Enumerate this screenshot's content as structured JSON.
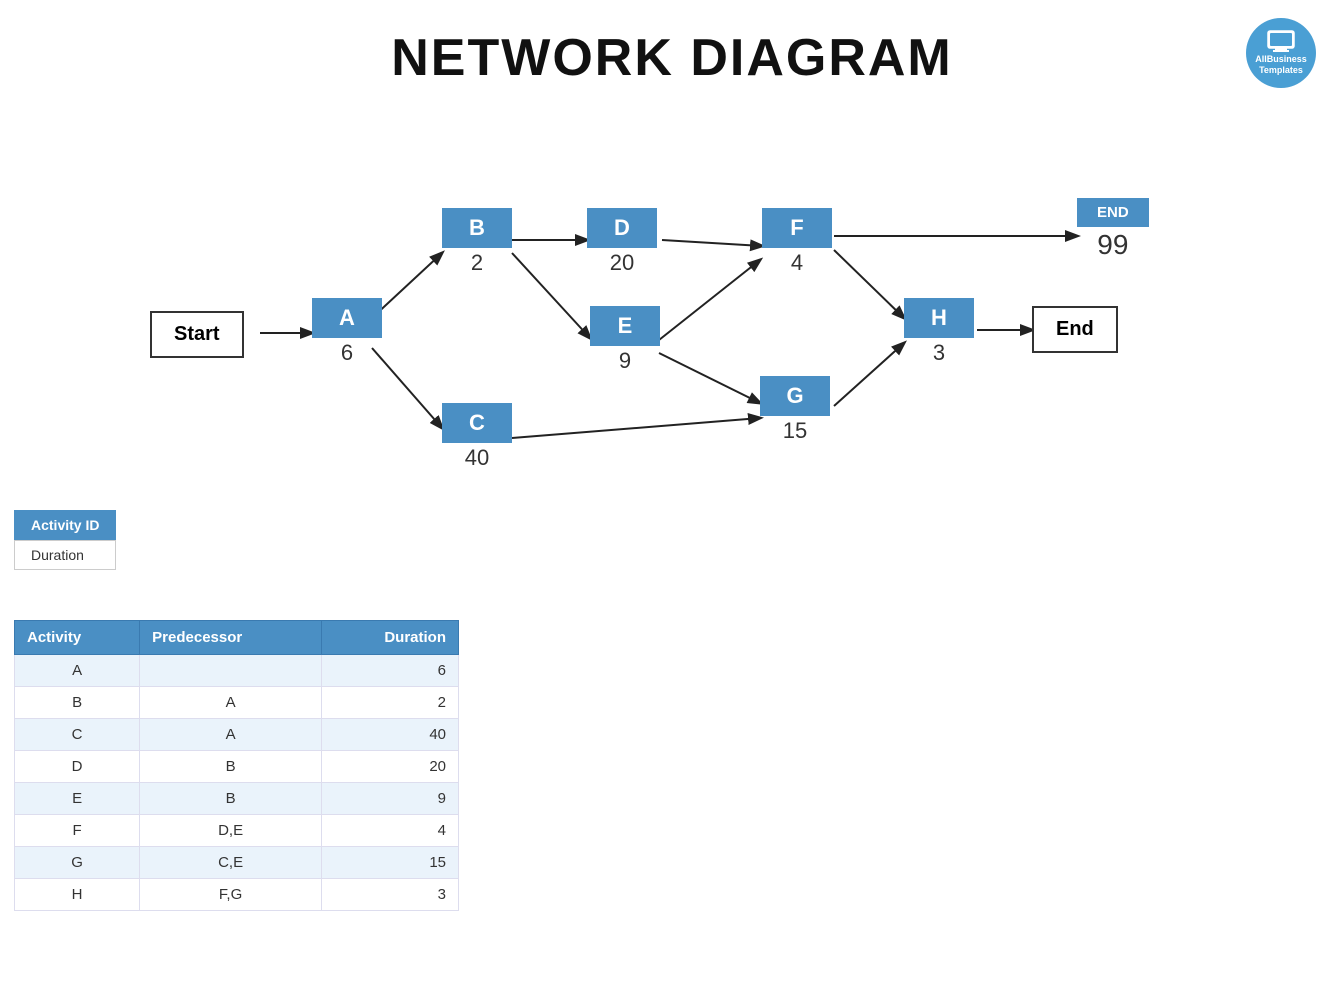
{
  "title": "NETWORK DIAGRAM",
  "logo": {
    "line1": "AllBusiness",
    "line2": "Templates"
  },
  "legend": {
    "activity_id_label": "Activity ID",
    "duration_label": "Duration"
  },
  "nodes": {
    "start": {
      "label": "Start",
      "duration": null
    },
    "end_node": {
      "label": "End",
      "duration": null
    },
    "end_special": {
      "label": "END",
      "duration": "99"
    },
    "A": {
      "label": "A",
      "duration": "6"
    },
    "B": {
      "label": "B",
      "duration": "2"
    },
    "C": {
      "label": "C",
      "duration": "40"
    },
    "D": {
      "label": "D",
      "duration": "20"
    },
    "E": {
      "label": "E",
      "duration": "9"
    },
    "F": {
      "label": "F",
      "duration": "4"
    },
    "G": {
      "label": "G",
      "duration": "15"
    },
    "H": {
      "label": "H",
      "duration": "3"
    }
  },
  "table": {
    "headers": [
      "Activity",
      "Predecessor",
      "Duration"
    ],
    "rows": [
      {
        "activity": "A",
        "predecessor": "",
        "duration": "6"
      },
      {
        "activity": "B",
        "predecessor": "A",
        "duration": "2"
      },
      {
        "activity": "C",
        "predecessor": "A",
        "duration": "40"
      },
      {
        "activity": "D",
        "predecessor": "B",
        "duration": "20"
      },
      {
        "activity": "E",
        "predecessor": "B",
        "duration": "9"
      },
      {
        "activity": "F",
        "predecessor": "D,E",
        "duration": "4"
      },
      {
        "activity": "G",
        "predecessor": "C,E",
        "duration": "15"
      },
      {
        "activity": "H",
        "predecessor": "F,G",
        "duration": "3"
      }
    ]
  }
}
